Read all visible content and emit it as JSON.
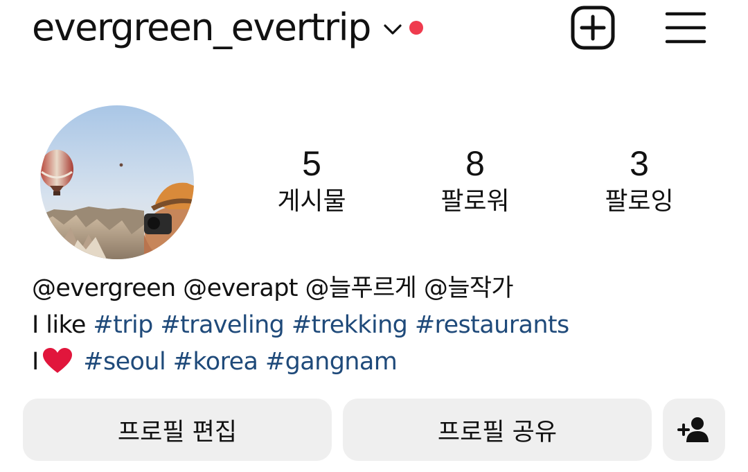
{
  "header": {
    "username": "evergreen_evertrip",
    "accent_dot_color": "#ef3b4e",
    "icons": {
      "switch_account": "chevron-down-icon",
      "create": "plus-square-icon",
      "menu": "hamburger-menu-icon"
    }
  },
  "profile": {
    "avatar_icon": "profile-photo-hot-air-balloons"
  },
  "stats": [
    {
      "value": "5",
      "label": "게시물"
    },
    {
      "value": "8",
      "label": "팔로워"
    },
    {
      "value": "3",
      "label": "팔로잉"
    }
  ],
  "bio": {
    "line1": {
      "mentions": [
        "@evergreen",
        "@everapt",
        "@늘푸르게",
        "@늘작가"
      ]
    },
    "line2": {
      "prefix": "I like",
      "tags": [
        "#trip",
        "#traveling",
        "#trekking",
        "#restaurants"
      ]
    },
    "line3": {
      "prefix": "I",
      "emoji_icon": "heart-icon",
      "heart_color": "#e1163c",
      "tags": [
        "#seoul",
        "#korea",
        "#gangnam"
      ]
    }
  },
  "actions": {
    "edit_profile": "프로필 편집",
    "share_profile": "프로필 공유",
    "discover_people_icon": "add-person-icon"
  },
  "colors": {
    "hashtag": "#1f4a7a",
    "button_bg": "#efefef",
    "text": "#111111"
  }
}
